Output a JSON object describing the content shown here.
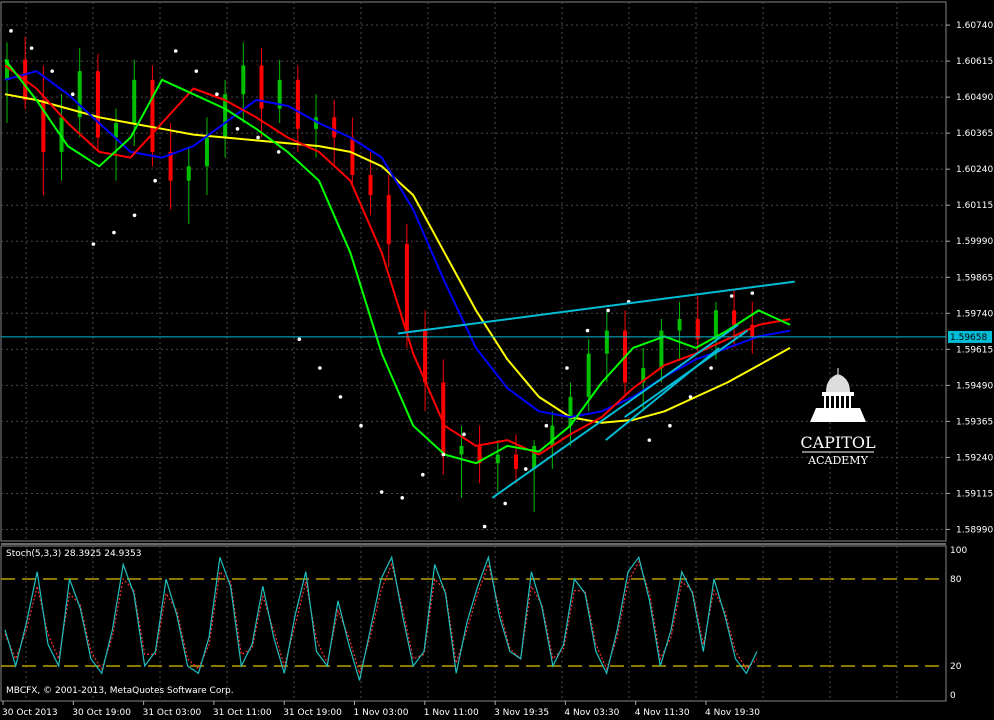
{
  "chart_data": {
    "type": "line",
    "main": {
      "y_ticks": [
        "1.60740",
        "1.60615",
        "1.60490",
        "1.60365",
        "1.60240",
        "1.60115",
        "1.59990",
        "1.59865",
        "1.59740",
        "1.59615",
        "1.59490",
        "1.59365",
        "1.59240",
        "1.59115",
        "1.58990"
      ],
      "ylim": [
        1.5895,
        1.6082
      ],
      "current_price": 1.59658,
      "current_price_label": "1.59658",
      "candles_trend": [
        [
          1.6055,
          1.6068,
          1.604,
          1.6062
        ],
        [
          1.6062,
          1.607,
          1.6045,
          1.6048
        ],
        [
          1.6048,
          1.606,
          1.6015,
          1.603
        ],
        [
          1.603,
          1.605,
          1.602,
          1.6042
        ],
        [
          1.6042,
          1.6066,
          1.6035,
          1.6058
        ],
        [
          1.6058,
          1.6064,
          1.603,
          1.6035
        ],
        [
          1.6035,
          1.6045,
          1.602,
          1.604
        ],
        [
          1.604,
          1.6062,
          1.6032,
          1.6055
        ],
        [
          1.6055,
          1.606,
          1.6025,
          1.603
        ],
        [
          1.603,
          1.604,
          1.601,
          1.602
        ],
        [
          1.602,
          1.6032,
          1.6005,
          1.6025
        ],
        [
          1.6025,
          1.6042,
          1.6015,
          1.6035
        ],
        [
          1.6035,
          1.6055,
          1.6028,
          1.605
        ],
        [
          1.605,
          1.6068,
          1.604,
          1.606
        ],
        [
          1.606,
          1.6066,
          1.6035,
          1.6045
        ],
        [
          1.6045,
          1.6062,
          1.604,
          1.6055
        ],
        [
          1.6055,
          1.606,
          1.603,
          1.6038
        ],
        [
          1.6038,
          1.605,
          1.6028,
          1.6042
        ],
        [
          1.6042,
          1.6048,
          1.6025,
          1.6035
        ],
        [
          1.6035,
          1.6042,
          1.6018,
          1.6022
        ],
        [
          1.6022,
          1.603,
          1.6008,
          1.6015
        ],
        [
          1.6015,
          1.6022,
          1.599,
          1.5998
        ],
        [
          1.5998,
          1.6005,
          1.5962,
          1.5968
        ],
        [
          1.5968,
          1.5975,
          1.594,
          1.595
        ],
        [
          1.595,
          1.5958,
          1.5918,
          1.5925
        ],
        [
          1.5925,
          1.5935,
          1.591,
          1.5928
        ],
        [
          1.5928,
          1.5935,
          1.5915,
          1.5922
        ],
        [
          1.5922,
          1.593,
          1.5912,
          1.5925
        ],
        [
          1.5925,
          1.5932,
          1.5915,
          1.592
        ],
        [
          1.592,
          1.593,
          1.5905,
          1.5928
        ],
        [
          1.5928,
          1.594,
          1.592,
          1.5935
        ],
        [
          1.5935,
          1.595,
          1.5928,
          1.5945
        ],
        [
          1.5945,
          1.5965,
          1.594,
          1.596
        ],
        [
          1.596,
          1.5975,
          1.595,
          1.5968
        ],
        [
          1.5968,
          1.5975,
          1.5945,
          1.595
        ],
        [
          1.595,
          1.5962,
          1.594,
          1.5955
        ],
        [
          1.5955,
          1.5972,
          1.595,
          1.5968
        ],
        [
          1.5968,
          1.5978,
          1.5958,
          1.5972
        ],
        [
          1.5972,
          1.598,
          1.596,
          1.5965
        ],
        [
          1.5965,
          1.5978,
          1.5958,
          1.5975
        ],
        [
          1.5975,
          1.5982,
          1.5962,
          1.597
        ],
        [
          1.597,
          1.5978,
          1.596,
          1.5966
        ]
      ],
      "ma_yellow": [
        1.605,
        1.6048,
        1.6045,
        1.6042,
        1.604,
        1.6038,
        1.6036,
        1.6035,
        1.6034,
        1.6033,
        1.6032,
        1.603,
        1.6025,
        1.6015,
        1.5995,
        1.5975,
        1.5958,
        1.5945,
        1.5938,
        1.5936,
        1.5937,
        1.594,
        1.5945,
        1.595,
        1.5956,
        1.5962
      ],
      "ma_blue": [
        1.6055,
        1.6058,
        1.605,
        1.604,
        1.603,
        1.6028,
        1.6032,
        1.604,
        1.6048,
        1.6046,
        1.604,
        1.6035,
        1.6028,
        1.601,
        1.5985,
        1.5962,
        1.5948,
        1.594,
        1.5938,
        1.594,
        1.5945,
        1.5952,
        1.5958,
        1.5962,
        1.5966,
        1.5968
      ],
      "ma_red": [
        1.606,
        1.6052,
        1.604,
        1.603,
        1.6028,
        1.604,
        1.6052,
        1.6048,
        1.6042,
        1.6035,
        1.603,
        1.602,
        1.5995,
        1.596,
        1.5935,
        1.5928,
        1.593,
        1.5925,
        1.5932,
        1.5938,
        1.5948,
        1.5956,
        1.596,
        1.5965,
        1.597,
        1.5972
      ],
      "ma_green": [
        1.6062,
        1.6048,
        1.6032,
        1.6025,
        1.6035,
        1.6055,
        1.605,
        1.6045,
        1.6038,
        1.603,
        1.602,
        1.5995,
        1.596,
        1.5935,
        1.5925,
        1.5922,
        1.5928,
        1.5926,
        1.5935,
        1.595,
        1.5962,
        1.5966,
        1.5962,
        1.5968,
        1.5975,
        1.597
      ],
      "psar": [
        1.6072,
        1.6066,
        1.6058,
        1.605,
        1.5998,
        1.6002,
        1.6008,
        1.602,
        1.6065,
        1.6058,
        1.605,
        1.6038,
        1.6035,
        1.603,
        1.5965,
        1.5955,
        1.5945,
        1.5935,
        1.5912,
        1.591,
        1.5918,
        1.5925,
        1.5932,
        1.59,
        1.5908,
        1.592,
        1.5935,
        1.5955,
        1.5968,
        1.5975,
        1.5978,
        1.593,
        1.5935,
        1.5945,
        1.5955,
        1.598,
        1.5981
      ]
    },
    "trendlines": [
      {
        "from": [
          0.42,
          1.5967
        ],
        "to": [
          0.84,
          1.5985
        ]
      },
      {
        "from": [
          0.52,
          1.591
        ],
        "to": [
          0.78,
          1.597
        ]
      },
      {
        "from": [
          0.64,
          1.593
        ],
        "to": [
          0.76,
          1.5962
        ]
      },
      {
        "from": [
          0.66,
          1.5938
        ],
        "to": [
          0.79,
          1.5968
        ]
      }
    ],
    "oscillator": {
      "label": "Stoch(5,3,3) 28.3925 24.9353",
      "y_ticks": [
        "100",
        "80",
        "20",
        "0"
      ],
      "levels": [
        80,
        20
      ],
      "k": [
        45,
        20,
        50,
        85,
        35,
        20,
        80,
        60,
        25,
        15,
        45,
        90,
        70,
        20,
        30,
        80,
        55,
        20,
        15,
        40,
        95,
        75,
        20,
        35,
        75,
        40,
        15,
        55,
        85,
        30,
        20,
        65,
        35,
        10,
        45,
        80,
        95,
        55,
        20,
        30,
        90,
        70,
        15,
        50,
        75,
        95,
        55,
        30,
        25,
        85,
        60,
        20,
        35,
        80,
        70,
        30,
        15,
        45,
        85,
        95,
        65,
        20,
        45,
        85,
        70,
        30,
        80,
        55,
        25,
        15,
        30
      ],
      "d": [
        42,
        25,
        45,
        75,
        42,
        25,
        70,
        62,
        30,
        18,
        40,
        80,
        72,
        28,
        28,
        70,
        58,
        25,
        18,
        35,
        85,
        78,
        28,
        32,
        68,
        45,
        20,
        48,
        78,
        38,
        22,
        58,
        40,
        15,
        40,
        72,
        90,
        60,
        25,
        28,
        80,
        72,
        22,
        45,
        70,
        90,
        60,
        32,
        25,
        75,
        62,
        25,
        32,
        72,
        72,
        35,
        18,
        40,
        78,
        92,
        70,
        25,
        40,
        78,
        72,
        35,
        72,
        58,
        30,
        18,
        25
      ]
    },
    "x_labels": [
      "30 Oct 2013",
      "30 Oct 19:00",
      "31 Oct 03:00",
      "31 Oct 11:00",
      "31 Oct 19:00",
      "1 Nov 03:00",
      "1 Nov 11:00",
      "3 Nov 19:35",
      "4 Nov 03:30",
      "4 Nov 11:30",
      "4 Nov 19:30"
    ],
    "copyright": "MBCFX, © 2001-2013, MetaQuotes Software Corp.",
    "logo": {
      "name": "CAPITOL",
      "sub": "ACADEMY"
    },
    "colors": {
      "background": "#000000",
      "grid": "#4a4a4a",
      "bull": "#00c000",
      "bear": "#ff0000",
      "ma_yellow": "#ffff00",
      "ma_blue": "#0000ff",
      "ma_red": "#ff0000",
      "ma_green": "#00ff00",
      "psar": "#ffffff",
      "trendline": "#00bcd4",
      "k": "#20c0c0",
      "d": "#ff3030",
      "levels": "#b8a000"
    }
  }
}
